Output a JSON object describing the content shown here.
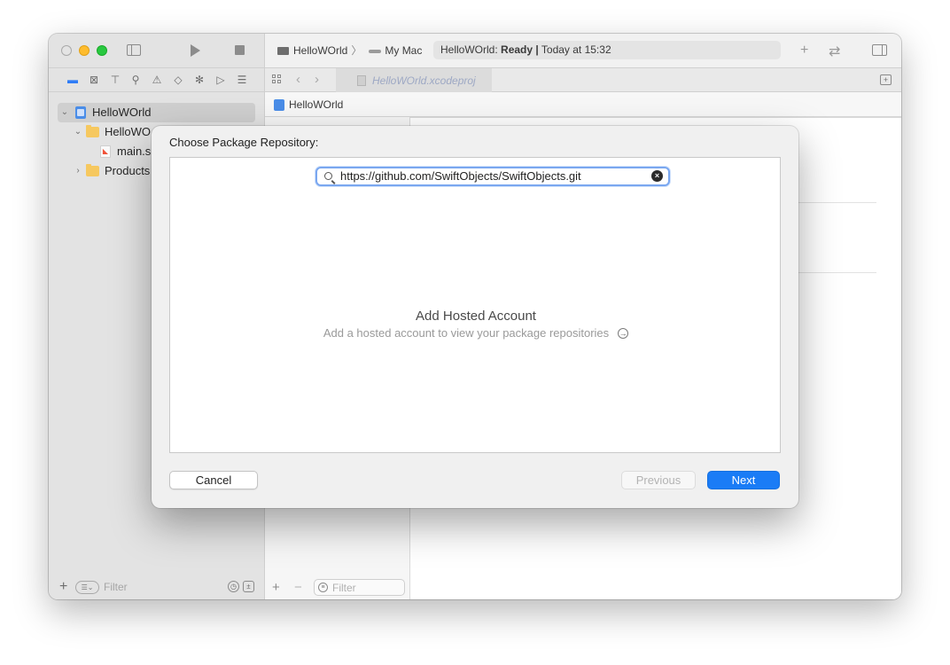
{
  "toolbar": {
    "scheme_target": "HelloWOrld",
    "scheme_destination": "My Mac",
    "status_project": "HelloWOrld:",
    "status_state": "Ready",
    "status_separator": "|",
    "status_time": "Today at 15:32"
  },
  "tab": {
    "label": "HelloWOrld.xcodeproj"
  },
  "jumpbar": {
    "label": "HelloWOrld"
  },
  "navigator": {
    "items": [
      {
        "label": "HelloWOrld",
        "type": "project"
      },
      {
        "label": "HelloWO",
        "type": "folder"
      },
      {
        "label": "main.s",
        "type": "swift-file"
      },
      {
        "label": "Products",
        "type": "folder"
      }
    ],
    "filter_placeholder": "Filter"
  },
  "editor": {
    "filter_placeholder": "Filter"
  },
  "sheet": {
    "title": "Choose Package Repository:",
    "search_value": "https://github.com/SwiftObjects/SwiftObjects.git",
    "hosted_title": "Add Hosted Account",
    "hosted_subtitle": "Add a hosted account to view your package repositories",
    "cancel_label": "Cancel",
    "previous_label": "Previous",
    "next_label": "Next"
  },
  "colors": {
    "accent": "#1a7cf6",
    "focus_ring": "#7aa7f0",
    "folder": "#f6c85f",
    "project": "#4a8de8"
  }
}
